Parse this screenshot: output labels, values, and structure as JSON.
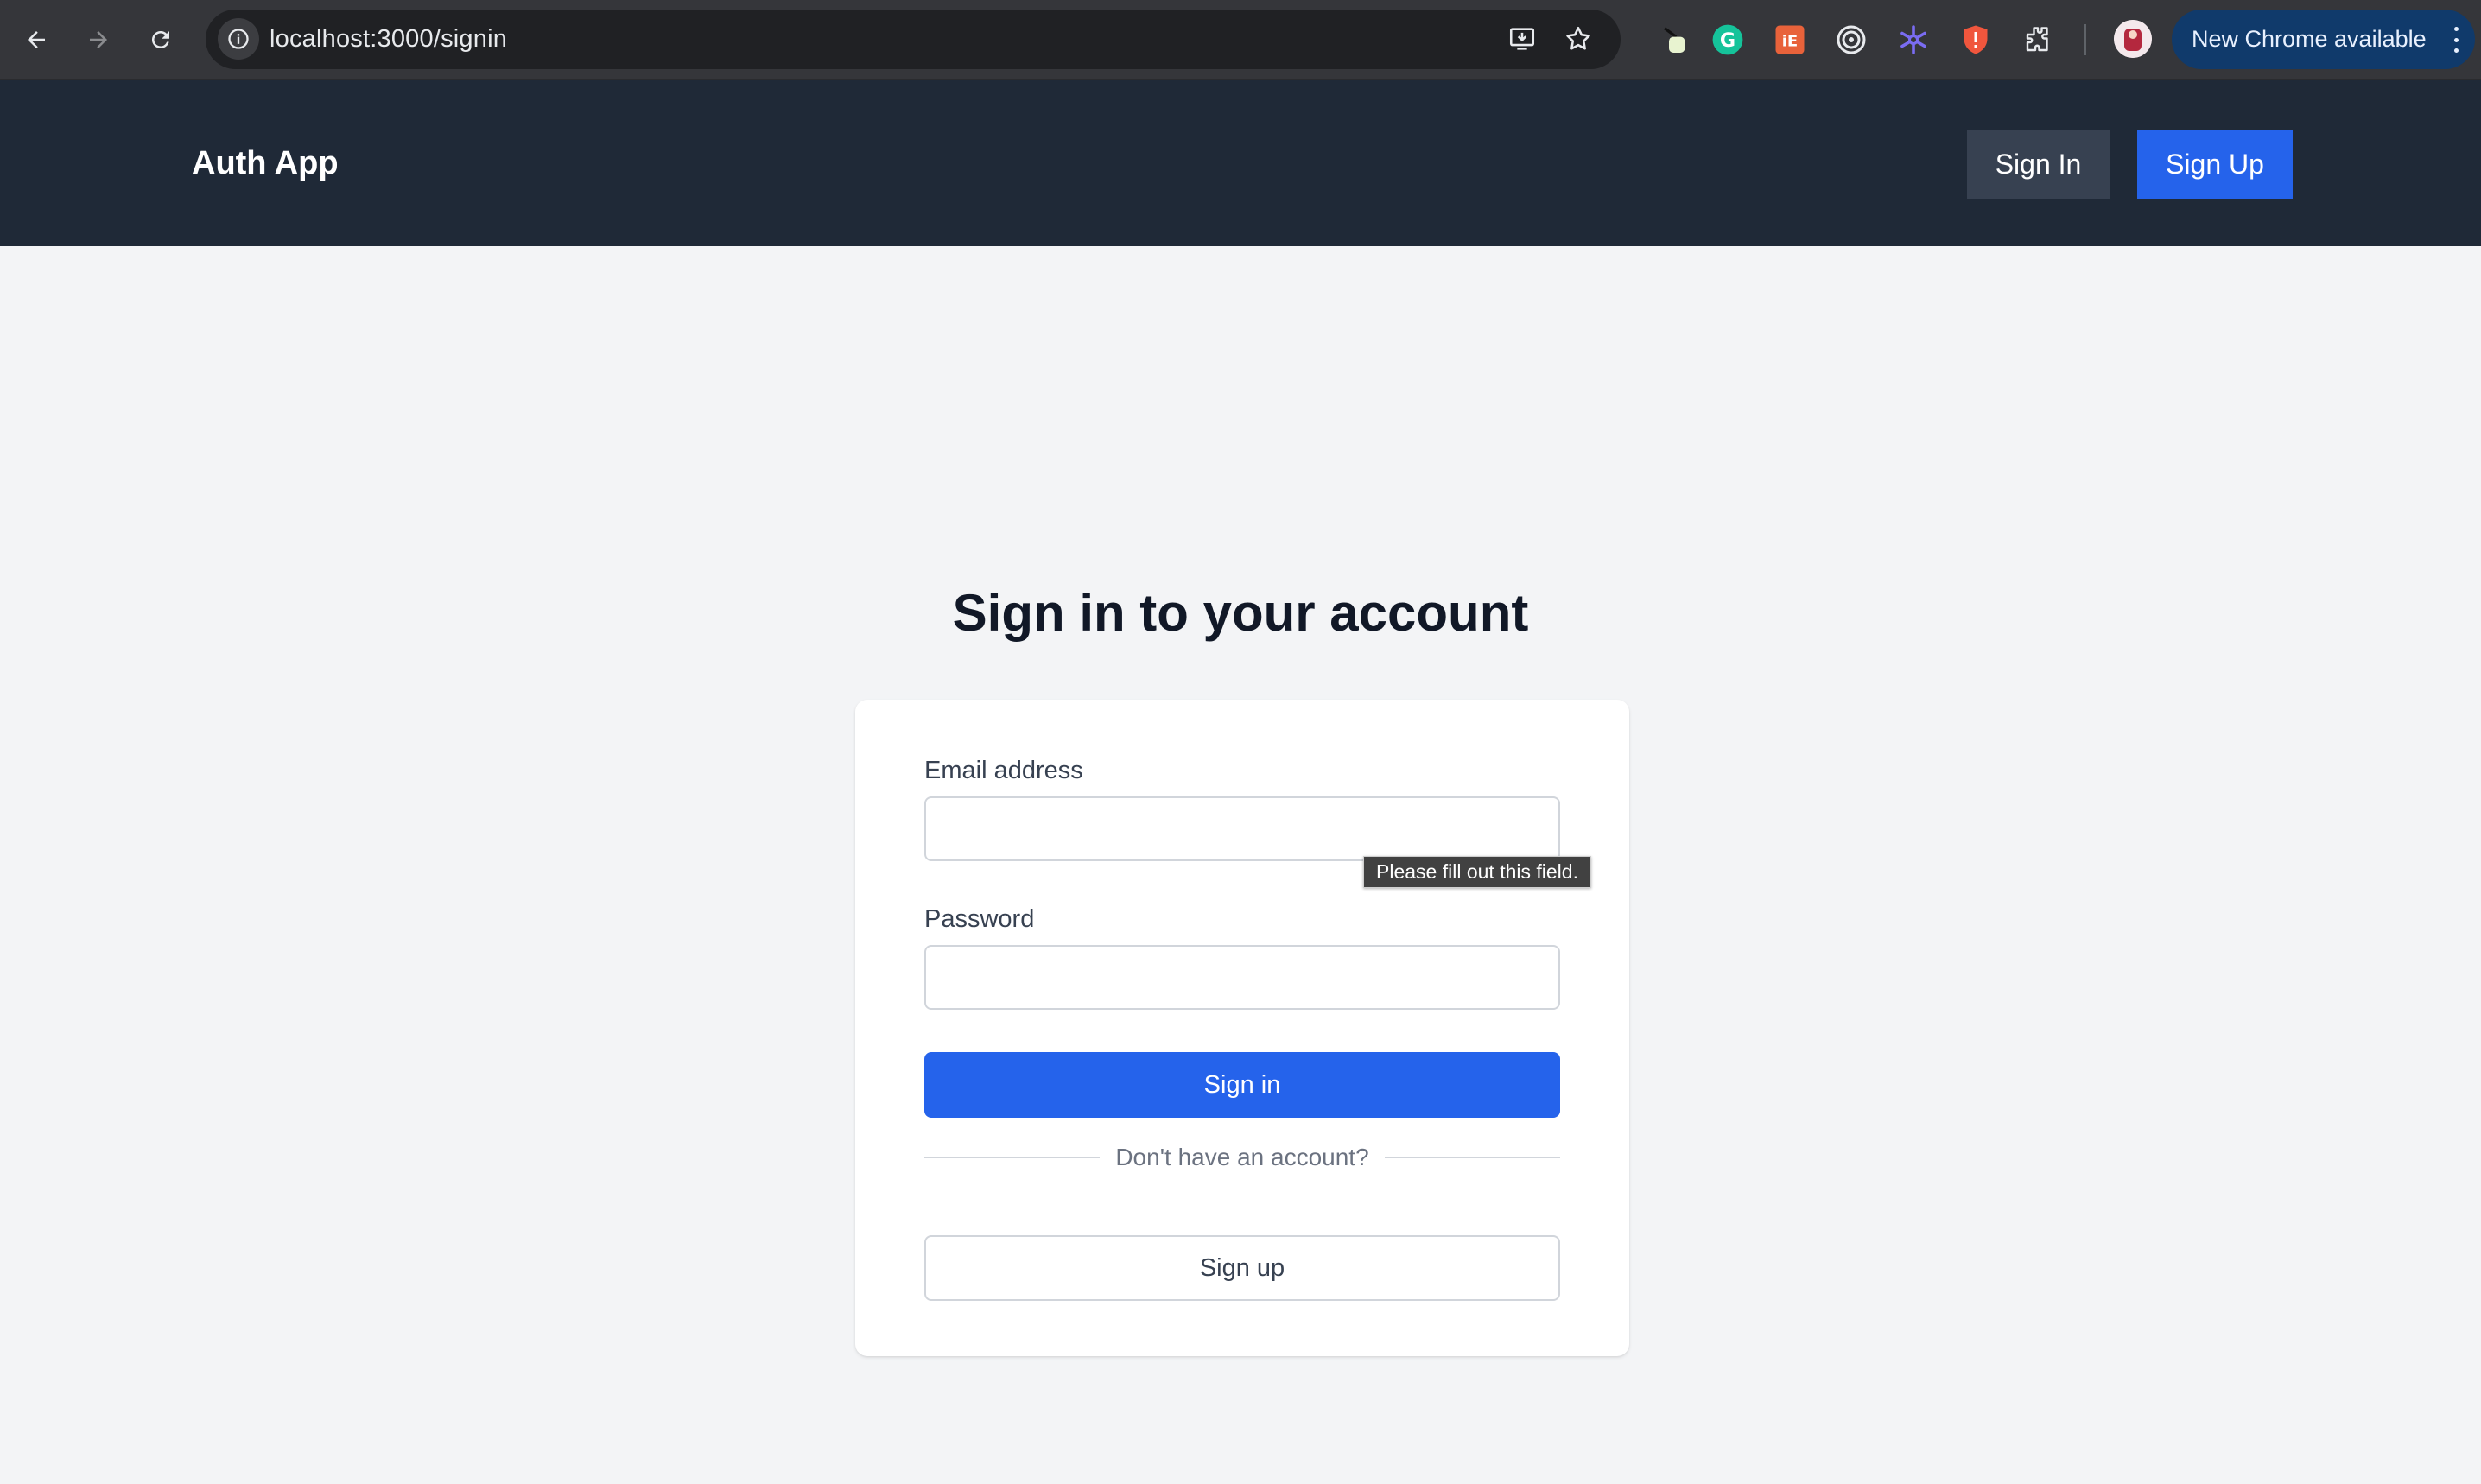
{
  "browser": {
    "url": "localhost:3000/signin",
    "update_label": "New Chrome available",
    "extensions": [
      "ink-extension-icon",
      "grammarly-icon",
      "ie-extension-icon",
      "target-extension-icon",
      "snowflake-extension-icon",
      "shield-extension-icon",
      "puzzle-extensions-icon"
    ]
  },
  "header": {
    "brand": "Auth App",
    "signin_label": "Sign In",
    "signup_label": "Sign Up"
  },
  "main": {
    "title": "Sign in to your account",
    "email_label": "Email address",
    "email_value": "",
    "password_label": "Password",
    "password_value": "",
    "validation_tooltip": "Please fill out this field.",
    "submit_label": "Sign in",
    "divider_text": "Don't have an account?",
    "signup_label": "Sign up"
  },
  "colors": {
    "header_bg": "#1f2937",
    "primary": "#2563eb",
    "page_bg": "#f3f4f6"
  }
}
